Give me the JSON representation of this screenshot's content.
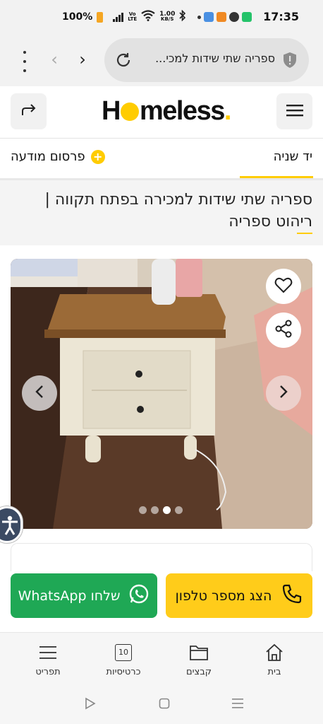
{
  "status_bar": {
    "battery": "100%",
    "net_speed_top": "1.00",
    "net_speed_bottom": "KB/S",
    "volte_top": "Vo",
    "volte_bottom": "LTE",
    "time": "17:35"
  },
  "browser": {
    "url_text": "ספריה שתי שידות למכי...",
    "icons": [
      "menu-dots-icon",
      "back-arrow-icon",
      "forward-arrow-icon",
      "reload-icon",
      "shield-icon"
    ]
  },
  "header": {
    "logo_parts": [
      "H",
      "meless",
      "."
    ],
    "share_icon": "share-arrow-icon",
    "menu_icon": "hamburger-icon"
  },
  "tabs": {
    "active": "יד שניה",
    "post_ad": "פרסום מודעה",
    "plus": "+"
  },
  "listing": {
    "title": "ספריה שתי שידות למכירה בפתח תקווה | ריהוט ספריה"
  },
  "gallery": {
    "image_count": 4,
    "active_index": 2
  },
  "actions": {
    "whatsapp": "שלחו WhatsApp",
    "phone": "הצג מספר טלפון"
  },
  "bottom_nav": {
    "items": [
      {
        "label": "בית",
        "icon": "home-icon"
      },
      {
        "label": "קבצים",
        "icon": "folder-icon"
      },
      {
        "label": "כרטיסיות",
        "icon": "tabs-counter-icon",
        "count": "10"
      },
      {
        "label": "תפריט",
        "icon": "menu-lines-icon"
      }
    ]
  },
  "colors": {
    "brand_yellow": "#ffcc00",
    "whatsapp_green": "#1fa855",
    "phone_yellow": "#ffcc1a"
  }
}
